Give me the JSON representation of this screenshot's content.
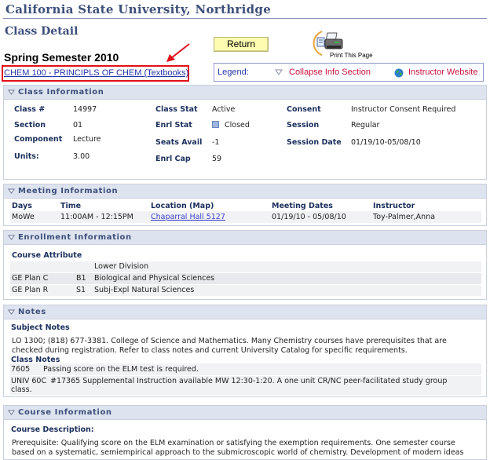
{
  "header": {
    "university": "California State University, Northridge",
    "page_title": "Class Detail",
    "term": "Spring Semester 2010",
    "course_link": "CHEM 100 - PRINCIPLS OF CHEM (Textbooks)",
    "return_label": "Return",
    "print_label": "Print This Page"
  },
  "legend": {
    "label": "Legend:",
    "collapse": "Collapse Info Section",
    "website": "Instructor Website"
  },
  "colors": {
    "accent": "#3d4f7a",
    "link": "#2436a8",
    "legend_text": "#c8123e",
    "highlight_box": "#e0101a",
    "section_header_bg": "#dde3ef",
    "return_button_bg": "#fdfcb0"
  },
  "class_info": {
    "title": "Class Information",
    "fields": {
      "class_no": {
        "label": "Class #",
        "value": "14997"
      },
      "section": {
        "label": "Section",
        "value": "01"
      },
      "component": {
        "label": "Component",
        "value": "Lecture"
      },
      "units": {
        "label": "Units:",
        "value": "3.00"
      },
      "class_stat": {
        "label": "Class Stat",
        "value": "Active"
      },
      "enrl_stat": {
        "label": "Enrl Stat",
        "value": "Closed"
      },
      "seats_avail": {
        "label": "Seats Avail",
        "value": "-1"
      },
      "enrl_cap": {
        "label": "Enrl Cap",
        "value": "59"
      },
      "consent": {
        "label": "Consent",
        "value": "Instructor Consent Required"
      },
      "session": {
        "label": "Session",
        "value": "Regular"
      },
      "session_date": {
        "label": "Session Date",
        "value": "01/19/10-05/08/10"
      }
    }
  },
  "meeting_info": {
    "title": "Meeting Information",
    "columns": [
      "Days",
      "Time",
      "Location (Map)",
      "Meeting Dates",
      "Instructor"
    ],
    "rows": [
      {
        "days": "MoWe",
        "time": "11:00AM - 12:15PM",
        "location": "Chaparral Hall 5127",
        "dates": "01/19/10 - 05/08/10",
        "instructor": "Toy-Palmer,Anna"
      }
    ]
  },
  "enrollment_info": {
    "title": "Enrollment Information",
    "subtitle": "Course Attribute",
    "rows": [
      {
        "plan": "",
        "code": "",
        "desc": "Lower Division"
      },
      {
        "plan": "GE Plan C",
        "code": "B1",
        "desc": "Biological and Physical Sciences"
      },
      {
        "plan": "GE Plan R",
        "code": "S1",
        "desc": "Subj-Expl Natural Sciences"
      }
    ]
  },
  "notes": {
    "title": "Notes",
    "subject_heading": "Subject Notes",
    "subject_text_line1": "LO 1300; (818) 677-3381. College of Science and Mathematics. Many Chemistry courses have prerequisites that are",
    "subject_text_line2": "checked during registration. Refer to class notes and current University Catalog for specific requirements.",
    "class_heading": "Class Notes",
    "class_notes": [
      {
        "code": "7605",
        "text": "Passing score on the ELM test is required."
      },
      {
        "code": "UNIV 60C",
        "text": "#17365 Supplemental Instruction available MW 12:30-1:20. A one unit CR/NC peer-facilitated study group",
        "text2": "class."
      }
    ]
  },
  "course_info": {
    "title": "Course Information",
    "desc_heading": "Course Description:",
    "desc_line1": "Prerequisite: Qualifying score on the ELM examination or satisfying the exemption requirements. One semester course",
    "desc_line2": "based on a systematic, semiempirical approach to the submicroscopic world of chemistry. Development of modern ideas"
  }
}
